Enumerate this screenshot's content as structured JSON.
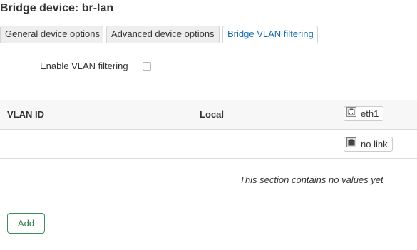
{
  "page": {
    "title": "Bridge device: br-lan"
  },
  "tabs": [
    {
      "label": "General device options",
      "active": false
    },
    {
      "label": "Advanced device options",
      "active": false
    },
    {
      "label": "Bridge VLAN filtering",
      "active": true
    }
  ],
  "vlan_filtering": {
    "label": "Enable VLAN filtering",
    "checked": false
  },
  "table": {
    "headers": {
      "vlan_id": "VLAN ID",
      "local": "Local"
    },
    "ports": [
      {
        "name": "eth1",
        "icon": "ethernet-port-icon"
      },
      {
        "name": "no link",
        "icon": "ethernet-port-disconnected-icon"
      }
    ],
    "empty_message": "This section contains no values yet"
  },
  "actions": {
    "add_label": "Add"
  },
  "colors": {
    "accent": "#1a6fb3",
    "add_button": "#2f7d4b",
    "header_bg": "#f7f7f7",
    "border": "#dddddd"
  }
}
